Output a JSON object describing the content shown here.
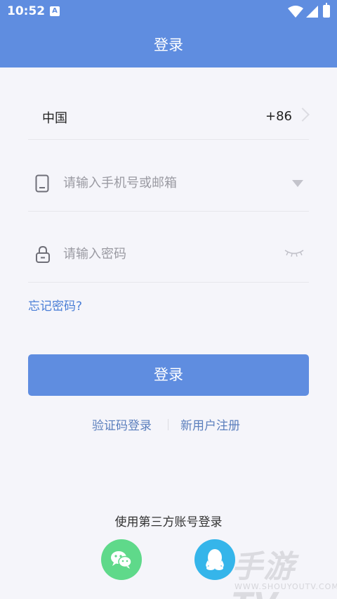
{
  "status_bar": {
    "time": "10:52",
    "notification_icon": "A"
  },
  "header": {
    "title": "登录"
  },
  "country": {
    "name": "中国",
    "code": "+86"
  },
  "phone": {
    "placeholder": "请输入手机号或邮箱",
    "value": ""
  },
  "password": {
    "placeholder": "请输入密码",
    "value": ""
  },
  "links": {
    "forgot_password": "忘记密码?",
    "sms_login": "验证码登录",
    "register": "新用户注册"
  },
  "login_button": {
    "label": "登录"
  },
  "third_party": {
    "label": "使用第三方账号登录",
    "providers": [
      "wechat-icon",
      "qq-icon"
    ]
  },
  "watermark": {
    "main": "手游TV",
    "sub": "WWW.SHOUYOUTV.COM"
  },
  "colors": {
    "primary": "#5f8de0",
    "link": "#4a7ed6",
    "wechat": "#5fd98a",
    "qq": "#35b5ea",
    "background": "#f5f5fa"
  }
}
